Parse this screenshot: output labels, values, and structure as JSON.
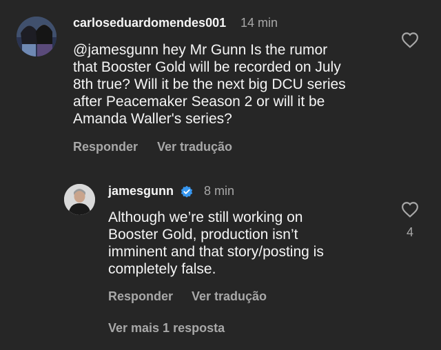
{
  "comment": {
    "username": "carloseduardomendes001",
    "time": "14 min",
    "text_lines": [
      "@jamesgunn hey Mr Gunn Is the rumor",
      "that Booster Gold will be recorded on July",
      "8th true? Will it be the next big DCU series",
      "after Peacemaker Season 2 or will it be",
      "Amanda Waller's series?"
    ],
    "reply_label": "Responder",
    "translate_label": "Ver tradução"
  },
  "reply": {
    "username": "jamesgunn",
    "time": "8 min",
    "text_lines": [
      "Although we’re still working on",
      "Booster Gold, production isn’t",
      "imminent and that story/posting is",
      "completely false."
    ],
    "reply_label": "Responder",
    "translate_label": "Ver tradução",
    "like_count": "4"
  },
  "view_more_label": "Ver mais 1 resposta",
  "colors": {
    "background": "#262626",
    "secondary_text": "#a8a8a8",
    "verified": "#3797f0"
  },
  "icons": [
    "heart-outline-icon",
    "verified-badge-icon"
  ]
}
